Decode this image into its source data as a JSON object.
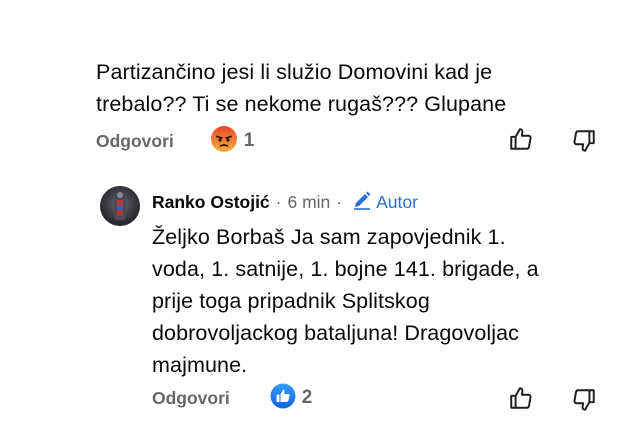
{
  "comment1": {
    "text_line1": "Partizančino jesi li služio Domovini kad je",
    "text_line2": "trebalo?? Ti se nekome rugaš??? Glupane",
    "reply_label": "Odgovori",
    "reaction_icon": "angry-reaction-icon",
    "reaction_count": "1"
  },
  "comment2": {
    "author": "Ranko Ostojić",
    "separator": "·",
    "time": "6 min",
    "separator2": "·",
    "author_badge": "Autor",
    "text_lines": [
      "Željko Borbaš Ja sam zapovjednik 1.",
      "voda, 1. satnije, 1. bojne 141. brigade, a",
      "prije toga pripadnik Splitskog",
      "dobrovoljackog bataljuna! Dragovoljac",
      "majmune."
    ],
    "reply_label": "Odgovori",
    "reaction_icon": "like-reaction-icon",
    "reaction_count": "2"
  },
  "colors": {
    "link_gray": "#65676b",
    "author_blue": "#2d6ecf",
    "like_blue": "#1877f2",
    "angry_orange": "#f0703c"
  }
}
